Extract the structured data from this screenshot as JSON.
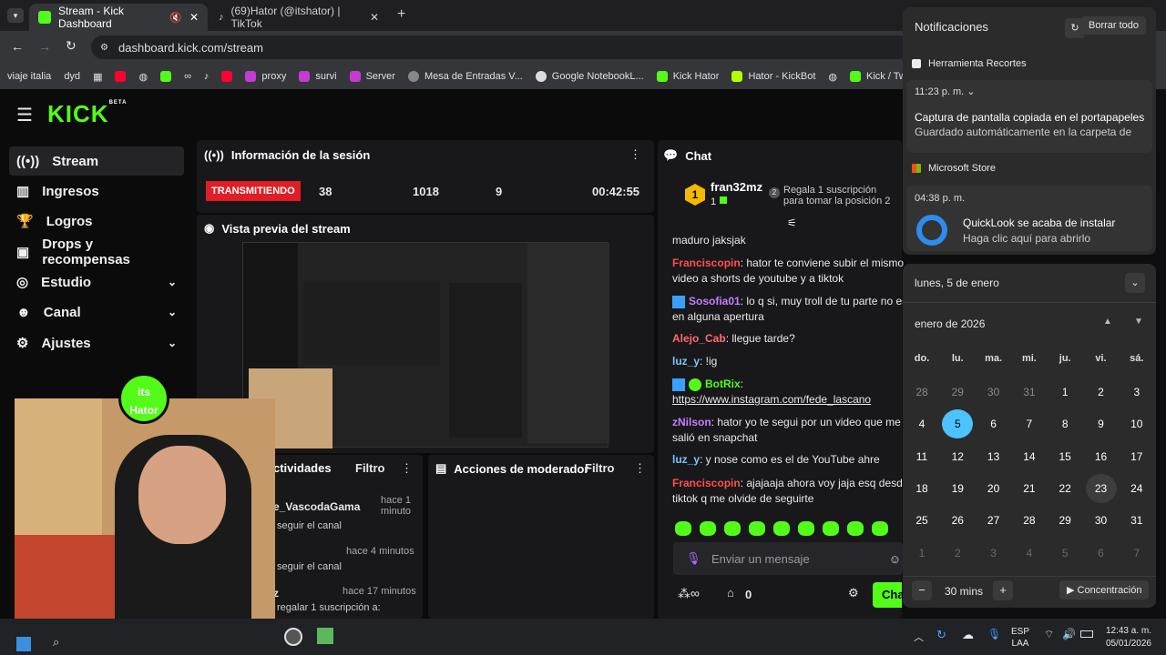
{
  "browser": {
    "tabs": [
      {
        "title": "Stream - Kick Dashboard",
        "icon": "kick-icon"
      },
      {
        "title": "(69)Hator (@itshator) | TikTok",
        "icon": "tiktok-icon"
      }
    ],
    "url": "dashboard.kick.com/stream",
    "bookmarks": [
      "viaje italia",
      "dyd",
      "proxy",
      "survi",
      "Server",
      "Mesa de Entradas V...",
      "Google NotebookL...",
      "Kick Hator",
      "Hator - KickBot",
      "Kick / Tw"
    ]
  },
  "logo": "KICK",
  "logo_sup": "BETA",
  "nav": [
    {
      "label": "Stream",
      "icon": "broadcast-icon"
    },
    {
      "label": "Ingresos",
      "icon": "chart-icon"
    },
    {
      "label": "Logros",
      "icon": "trophy-icon"
    },
    {
      "label": "Drops y recompensas",
      "icon": "gift-icon"
    },
    {
      "label": "Estudio",
      "icon": "studio-icon"
    },
    {
      "label": "Canal",
      "icon": "person-icon"
    },
    {
      "label": "Ajustes",
      "icon": "gear-icon"
    }
  ],
  "session": {
    "title": "Información de la sesión",
    "status": "TRANSMITIENDO",
    "stats": [
      "38",
      "1018",
      "9",
      "00:42:55"
    ]
  },
  "preview": {
    "title": "Vista previa del stream"
  },
  "activity": {
    "title": "Actividades",
    "title_visible": "ctividades",
    "filter": "Filtro",
    "items": [
      {
        "user": "e_VascodaGama",
        "time": "hace 1 minuto",
        "action": "seguir el canal"
      },
      {
        "user": "",
        "time": "hace 4 minutos",
        "action": "seguir el canal"
      },
      {
        "user": "z",
        "time": "hace 17 minutos",
        "action": "regalar 1 suscripción a:"
      }
    ]
  },
  "moderator": {
    "title": "Acciones de moderador",
    "filter": "Filtro"
  },
  "chat": {
    "title": "Chat",
    "top_gifter": {
      "name": "fran32mz",
      "count": "1",
      "rank": "1"
    },
    "gift_prompt": "Regala 1 suscripción para tomar la posición 2",
    "gift_rank": "2",
    "messages": [
      {
        "user": "",
        "text": "maduro jaksjak",
        "color": "#e8e8e8"
      },
      {
        "user": "Franciscopin",
        "text": ": hator te conviene subir el mismo",
        "cont": "video a shorts de youtube y a tiktok",
        "color": "#ff4f4f"
      },
      {
        "user": "Sosofia01",
        "text": ": lo q si, muy troll de tu parte no esta",
        "cont": "en alguna apertura",
        "color": "#c77dff"
      },
      {
        "user": "Alejo_Cab",
        "text": ": llegue tarde?",
        "color": "#ff6b6b"
      },
      {
        "user": "luz_y",
        "text": ": !ig",
        "color": "#7cc4ff"
      },
      {
        "user": "BotRix",
        "text": ":",
        "cont": "https://www.instagram.com/fede_lascano",
        "color": "#53fc18"
      },
      {
        "user": "zNilson",
        "text": ": hator yo te segui por un video que me",
        "cont": "salió en snapchat",
        "color": "#c77dff"
      },
      {
        "user": "luz_y",
        "text": ": y nose como es el de YouTube ahre",
        "color": "#7cc4ff"
      },
      {
        "user": "Franciscopin",
        "text": ": ajajaaja ahora voy jaja esq desde",
        "cont": "tiktok q me olvide de seguirte",
        "color": "#ff4f4f"
      }
    ],
    "placeholder": "Enviar un mensaje",
    "bottom_count": "0",
    "send_label": "Chat",
    "send_visible": "Cha"
  },
  "notifications": {
    "title": "Notificaciones",
    "clear": "Borrar todo",
    "groups": [
      {
        "app": "Herramienta Recortes",
        "time": "11:23 p. m.",
        "line1": "Captura de pantalla copiada en el portapapeles",
        "line2": "Guardado automáticamente en la carpeta de"
      },
      {
        "app": "Microsoft Store",
        "time": "04:38 p. m.",
        "line1": "QuickLook se acaba de instalar",
        "line2": "Haga clic aquí para abrirlo"
      }
    ]
  },
  "calendar": {
    "date_title": "lunes, 5 de enero",
    "month": "enero de 2026",
    "weekdays": [
      "do.",
      "lu.",
      "ma.",
      "mi.",
      "ju.",
      "vi.",
      "sá."
    ],
    "days": [
      "28",
      "29",
      "30",
      "31",
      "1",
      "2",
      "3",
      "4",
      "5",
      "6",
      "7",
      "8",
      "9",
      "10",
      "11",
      "12",
      "13",
      "14",
      "15",
      "16",
      "17",
      "18",
      "19",
      "20",
      "21",
      "22",
      "23",
      "24",
      "25",
      "26",
      "27",
      "28",
      "29",
      "30",
      "31",
      "1",
      "2",
      "3",
      "4",
      "5",
      "6",
      "7"
    ],
    "today": "5",
    "focus_minutes": "30 mins",
    "focus_label": "Concentración"
  },
  "taskbar": {
    "lang1": "ESP",
    "lang2": "LAA",
    "time": "12:43 a. m.",
    "date": "05/01/2026"
  },
  "colors": {
    "kick_green": "#53fc18",
    "live_red": "#e01e25",
    "today_blue": "#4cc2ff"
  }
}
